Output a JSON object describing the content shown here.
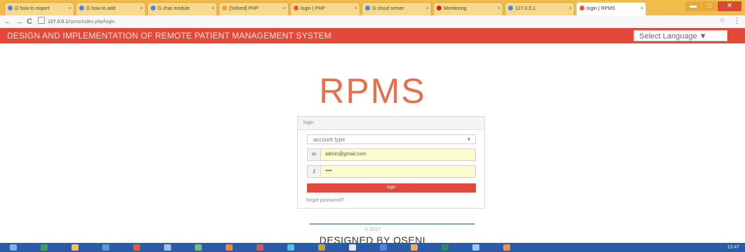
{
  "browser": {
    "tabs": [
      {
        "label": "G how to export",
        "fav": "#4a86e8"
      },
      {
        "label": "G how to add",
        "fav": "#4a86e8"
      },
      {
        "label": "G chat module",
        "fav": "#4a86e8"
      },
      {
        "label": "[Solved] PHP",
        "fav": "#e8a33b"
      },
      {
        "label": "login | PHP",
        "fav": "#e05a3b"
      },
      {
        "label": "G cloud server",
        "fav": "#4a86e8"
      },
      {
        "label": "Monitoring",
        "fav": "#cc2222"
      },
      {
        "label": "127.0.0.1",
        "fav": "#4a86e8"
      },
      {
        "label": "login | RPMS",
        "fav": "#e05a3b",
        "active": true
      }
    ],
    "back_glyph": "←",
    "forward_glyph": "→",
    "reload_glyph": "C",
    "url_host": "127.0.0.1",
    "url_path": "/rpms/index.php/login",
    "star_glyph": "☆",
    "menu_glyph": "⋮"
  },
  "app": {
    "header_title": "DESIGN AND IMPLEMENTATION OF REMOTE PATIENT MANAGEMENT SYSTEM",
    "language_select": "Select Language ▼",
    "logo": "RPMS",
    "colors": {
      "brand": "#e2493a",
      "logo": "#ea6d4d",
      "input_bg": "#fbfdcf"
    }
  },
  "login": {
    "panel_title": "login",
    "account_type": "account type",
    "email_icon": "envelope-icon",
    "email_value": "admin@gmail.com",
    "password_icon": "key-icon",
    "password_value": "••••",
    "button_label": "login",
    "forgot_link": "forgot password?"
  },
  "footer": {
    "copyright": "© 2017",
    "designed_by": "DESIGNED BY OSENI"
  },
  "taskbar": {
    "clock": "10:47"
  }
}
